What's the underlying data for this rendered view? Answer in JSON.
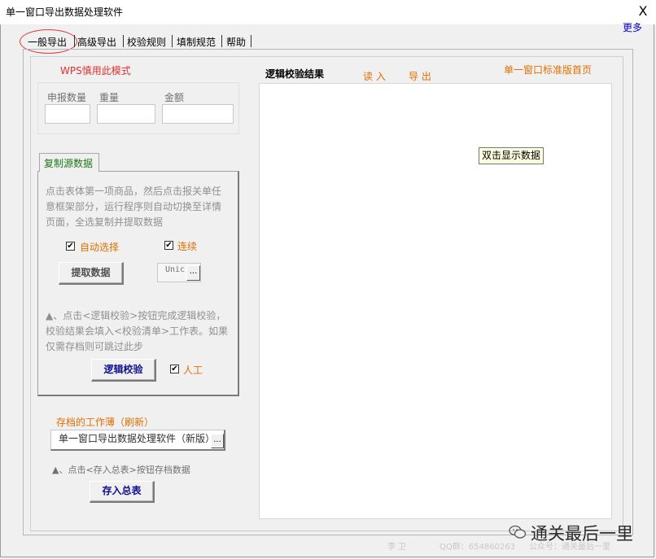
{
  "window": {
    "title": "单一窗口导出数据处理软件",
    "close_glyph": "X",
    "more_link": "更多"
  },
  "tabs": [
    "一般导出",
    "高级导出",
    "校验规则",
    "填制规范",
    "帮助"
  ],
  "left": {
    "wps_note": "WPS慎用此模式",
    "stats": {
      "qty_label": "申报数量",
      "weight_label": "重量",
      "amount_label": "金额"
    },
    "copy_tab": "复制源数据",
    "instructions_1": [
      "点击表体第一项商品，然后点击报关单任",
      "意框架部分，运行程序则自动切换至详情",
      "页面，全选复制并提取数据"
    ],
    "auto_select_label": "自动选择",
    "continuous_label": "连续",
    "extract_button": "提取数据",
    "unic_value": "Unic",
    "ellipsis": "...",
    "instructions_2": [
      "▲、点击<逻辑校验>按钮完成逻辑校验，",
      "校验结果会填入<校验清单>工作表。如果",
      "仅需存档则可跳过此步"
    ],
    "logic_check_button": "逻辑校验",
    "manual_label": "人工",
    "archive_label": "存档的工作薄（刷新）",
    "archive_value": "单一窗口导出数据处理软件（新版）",
    "archive_note": "▲、点击<存入总表>按钮存档数据",
    "save_total_button": "存入总表"
  },
  "right": {
    "result_title": "逻辑校验结果",
    "read_link": "读 入",
    "export_link": "导 出",
    "homepage_link": "单一窗口标准版首页",
    "tooltip": "双击显示数据"
  },
  "footer": {
    "author": "李 卫",
    "qq": "QQ群：654860263",
    "wechat": "公众号：通关最后一里",
    "watermark": "通关最后一里"
  },
  "colors": {
    "orange": "#e07000",
    "red": "#e03030",
    "green": "#1a7a1a",
    "blue": "#101090",
    "link": "#0000cc"
  }
}
